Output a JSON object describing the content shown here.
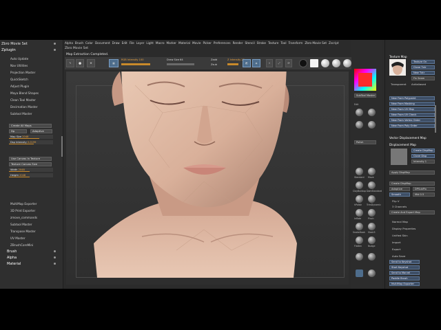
{
  "menubar": {
    "items": [
      "Alpha",
      "Brush",
      "Color",
      "Document",
      "Draw",
      "Edit",
      "File",
      "Layer",
      "Light",
      "Macro",
      "Marker",
      "Material",
      "Movie",
      "Picker",
      "Preferences",
      "Render",
      "Stencil",
      "Stroke",
      "Texture",
      "Tool",
      "Transform",
      "Zbro Movie Set",
      "Zscript"
    ]
  },
  "app_title": "Zbro Movie Set",
  "status_message": "Map Extraction Completed.",
  "toolbar": {
    "draw_sizes": "Draw Size 64",
    "rgb_intensity": "RGB Intensity 100",
    "zadd": "Zadd",
    "zsub": "Zsub",
    "zintensity": "Z Intensity 25"
  },
  "left_panel": {
    "top_title": "Zbro Movie Set",
    "section_title": "Zplugin",
    "items": [
      "Auto Update",
      "Nav Utilities",
      "Projection Master",
      "QuickSketch",
      "Adjust Plugin",
      "Maya Blend Shapes",
      "Clean Tool Master",
      "Decimation Master",
      "Subtool Master"
    ],
    "multi_map": "MultiMap Exporter",
    "buttons": {
      "create_all": "Create All Maps",
      "dp": "Dp",
      "adaptive": "Adaptive",
      "use_cavity": "Use Canvas In Texture",
      "texture_from": "Texture Canvas Size"
    },
    "sliders": [
      {
        "label": "Map Size",
        "value": "2048"
      },
      {
        "label": "Dsp Intensity",
        "value": "0.0199"
      },
      {
        "label": "Width",
        "value": "2048"
      },
      {
        "label": "Height",
        "value": "2048"
      }
    ],
    "lower_items": [
      "MultiMap Exporter",
      "3D Print Exporter",
      "zmove_commands",
      "Subtool Master",
      "Transpose Master",
      "UV Master",
      "ZBrushCoreMini"
    ],
    "palettes": [
      "Brush",
      "Alpha",
      "Material"
    ]
  },
  "right_strip": {
    "edit": "Edit",
    "sub_hide": "SubTool Master",
    "brushes": [
      "Standard",
      "Move",
      "ClayBuildup",
      "DamStandard",
      "hPolish",
      "TrimDynamic",
      "Inflate",
      "Pinch",
      "SnakeHook",
      "Slash3",
      "Flatten",
      "Nudge"
    ],
    "buttons": [
      "Polish"
    ]
  },
  "right_panel": {
    "texture_map_title": "Texture Map",
    "texture_buttons": [
      "New From Polypaint",
      "New From Masking",
      "New From UV Map",
      "New From UV Check",
      "New From Vertex Order",
      "New From Poly Order"
    ],
    "texture_on": "Texture On",
    "clone_txtr": "Clone Txtr",
    "new_txtr": "New Txtr",
    "fill_tx": "Fix Seam",
    "transparent": "Transparent",
    "antialiased": "Antialiased",
    "vector_disp_title": "Vector Displacement Map",
    "displacement_title": "Displacement Map",
    "disp_buttons": [
      "Create DispMap",
      "Clone Disp",
      "Intensity 1"
    ],
    "apply_dispmap": "Apply DispMap",
    "create_dispmap": "Create DispMap",
    "adaptive": "Adaptive",
    "dpsubpix": "DPSubPix",
    "smooth": "Smooth",
    "mid": "Mid 0.5",
    "uv": "Flip V",
    "channels": "3 Channels",
    "create_mod": "Create And Export Map",
    "other_items": [
      "Normal Map",
      "Display Properties",
      "Unified Skin",
      "Import",
      "Export",
      "Auto Save"
    ],
    "send_buttons": [
      "Send to Keyshot",
      "Start Keyshot",
      "Send to Marvel",
      "Paddle Brush",
      "MultiMap Exporter"
    ]
  }
}
